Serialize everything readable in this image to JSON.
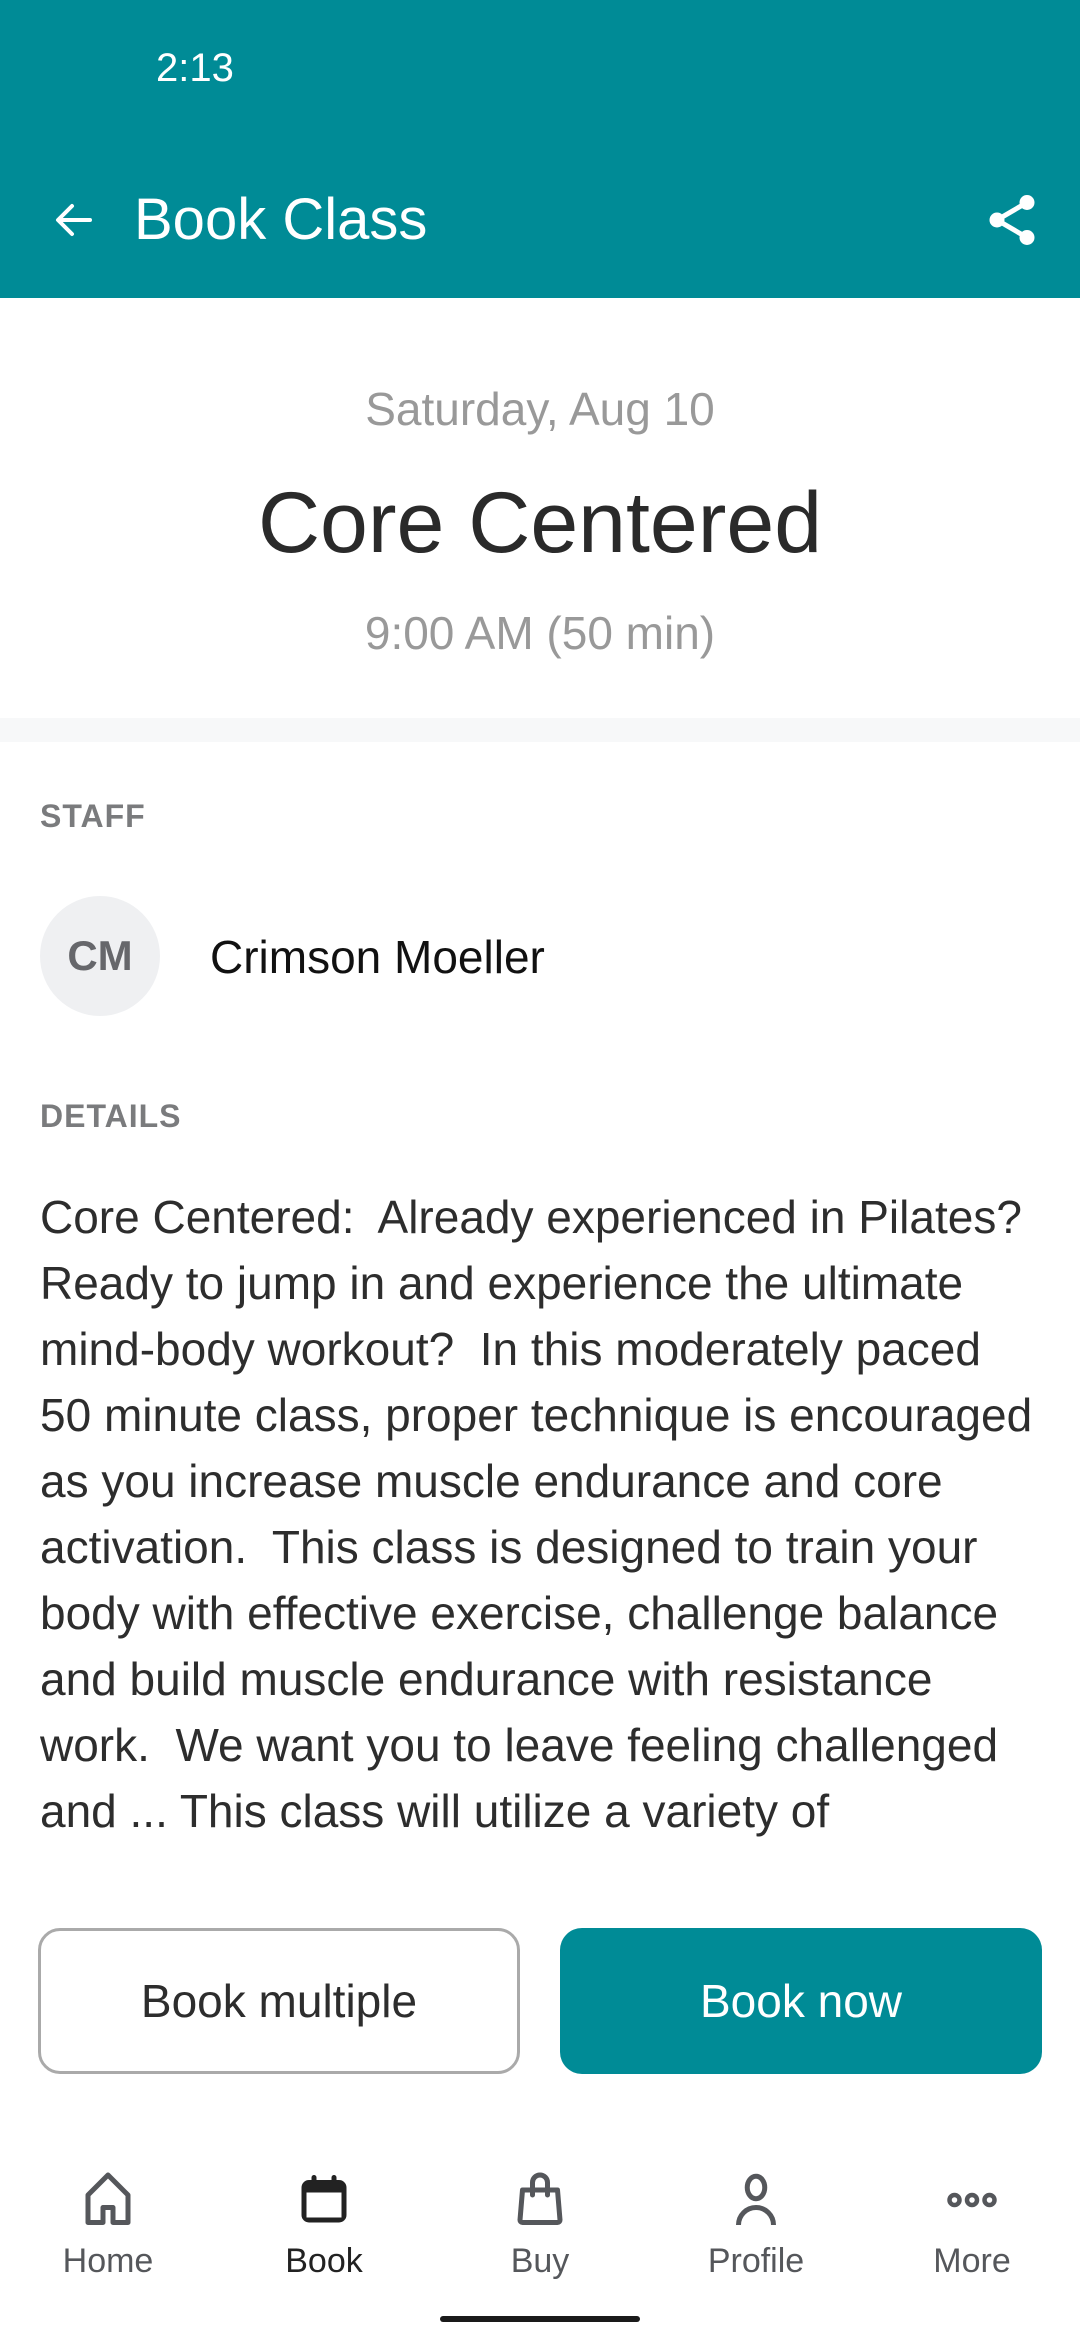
{
  "status_bar": {
    "time": "2:13"
  },
  "appbar": {
    "title": "Book Class",
    "back_icon": "arrow-back-icon",
    "share_icon": "share-icon",
    "color": "#008b96"
  },
  "class_info": {
    "date": "Saturday, Aug 10",
    "name": "Core Centered",
    "time": "9:00 AM (50 min)"
  },
  "staff": {
    "section_label": "STAFF",
    "initials": "CM",
    "name": "Crimson Moeller"
  },
  "details": {
    "section_label": "DETAILS",
    "text": "Core Centered:  Already experienced in Pilates? Ready to jump in and experience the ultimate mind-body workout?  In this moderately paced  50 minute class, proper technique is encouraged as you increase muscle endurance and core activation.  This class is designed to train your body with effective exercise, challenge balance and build muscle endurance with resistance work.  We want you to leave feeling challenged and ... This class will utilize a variety of"
  },
  "actions": {
    "book_multiple": "Book multiple",
    "book_now": "Book now"
  },
  "bottom_nav": {
    "items": [
      {
        "label": "Home",
        "icon": "home-icon",
        "active": false
      },
      {
        "label": "Book",
        "icon": "calendar-icon",
        "active": true
      },
      {
        "label": "Buy",
        "icon": "shopping-bag-icon",
        "active": false
      },
      {
        "label": "Profile",
        "icon": "person-icon",
        "active": false
      },
      {
        "label": "More",
        "icon": "more-horizontal-icon",
        "active": false
      }
    ]
  }
}
